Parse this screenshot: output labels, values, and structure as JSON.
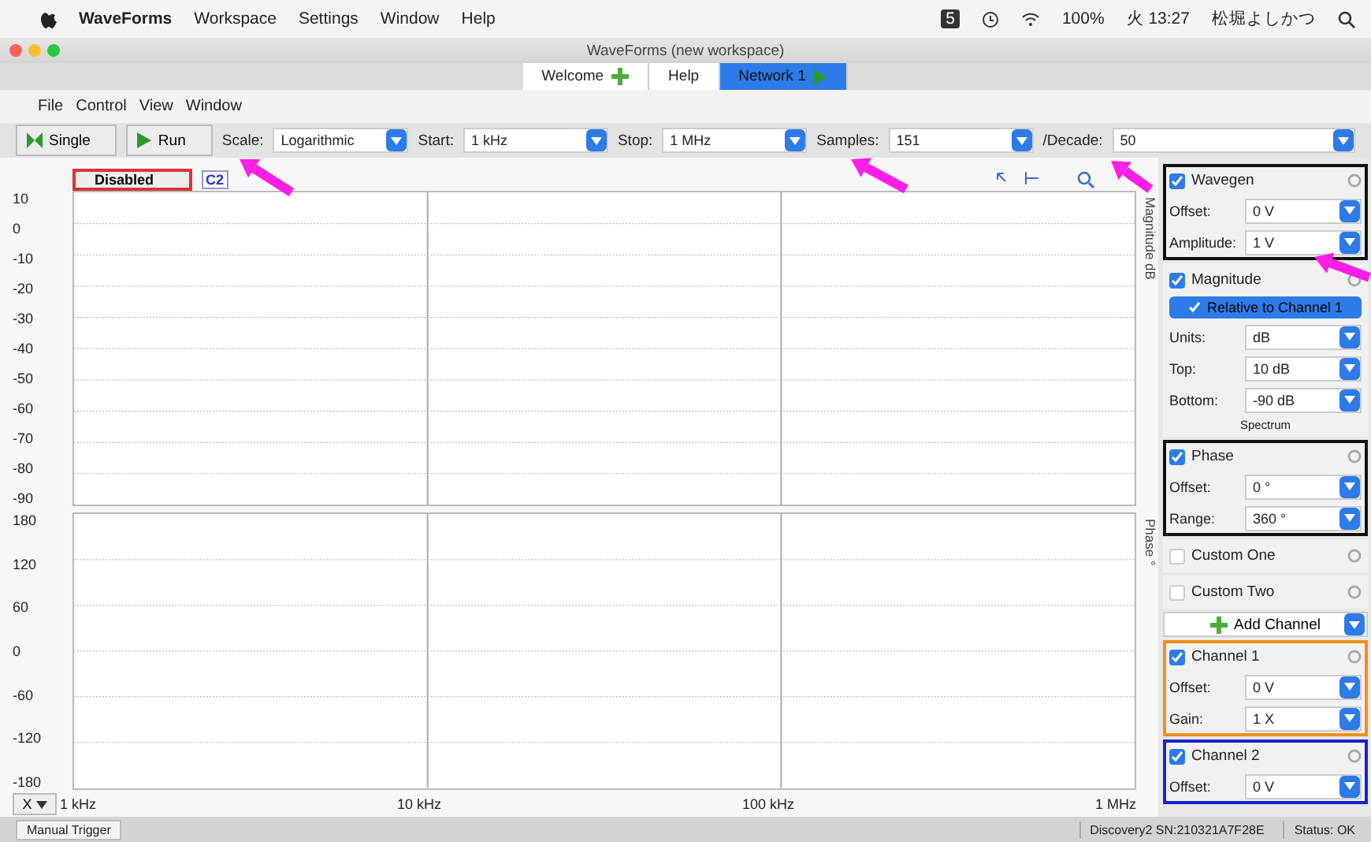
{
  "menubar": {
    "app": "WaveForms",
    "items": [
      "Workspace",
      "Settings",
      "Window",
      "Help"
    ],
    "status_badge": "5",
    "battery": "100%",
    "clock": "火 13:27",
    "user": "松堀よしかつ"
  },
  "window": {
    "title": "WaveForms (new workspace)"
  },
  "tabs": [
    {
      "label": "Welcome",
      "kind": "add",
      "selected": false
    },
    {
      "label": "Help",
      "kind": "plain",
      "selected": false
    },
    {
      "label": "Network 1",
      "kind": "run",
      "selected": true
    }
  ],
  "menu": [
    "File",
    "Control",
    "View",
    "Window"
  ],
  "toolbar": {
    "single": "Single",
    "run": "Run",
    "scale_label": "Scale:",
    "scale": "Logarithmic",
    "start_label": "Start:",
    "start": "1 kHz",
    "stop_label": "Stop:",
    "stop": "1 MHz",
    "samples_label": "Samples:",
    "samples": "151",
    "decade_label": "/Decade:",
    "decade": "50"
  },
  "plot": {
    "disabled": "Disabled",
    "channel_tag": "C2",
    "magnitude": {
      "title": "Magnitude dB",
      "y_labels": [
        "10",
        "0",
        "-10",
        "-20",
        "-30",
        "-40",
        "-50",
        "-60",
        "-70",
        "-80",
        "-90"
      ]
    },
    "phase": {
      "title": "Phase °",
      "y_labels": [
        "180",
        "120",
        "60",
        "0",
        "-60",
        "-120",
        "-180"
      ]
    },
    "x_button": "X",
    "x_labels": [
      "1 kHz",
      "10 kHz",
      "100 kHz",
      "1 MHz"
    ]
  },
  "panel": [
    {
      "kind": "section",
      "title": "Wavegen",
      "checked": true,
      "color": "#111111",
      "fields": [
        {
          "label": "Offset:",
          "value": "0 V"
        },
        {
          "label": "Amplitude:",
          "value": "1 V"
        }
      ]
    },
    {
      "kind": "section",
      "title": "Magnitude",
      "checked": true,
      "button": "Relative to Channel 1",
      "fields": [
        {
          "label": "Units:",
          "value": "dB"
        },
        {
          "label": "Top:",
          "value": "10 dB"
        },
        {
          "label": "Bottom:",
          "value": "-90 dB"
        }
      ],
      "footer": "Spectrum"
    },
    {
      "kind": "section",
      "title": "Phase",
      "checked": true,
      "color": "#111111",
      "fields": [
        {
          "label": "Offset:",
          "value": "0 °"
        },
        {
          "label": "Range:",
          "value": "360 °"
        }
      ]
    },
    {
      "kind": "section",
      "title": "Custom One",
      "checked": false
    },
    {
      "kind": "section",
      "title": "Custom Two",
      "checked": false
    },
    {
      "kind": "add",
      "title": "Add Channel"
    },
    {
      "kind": "section",
      "title": "Channel 1",
      "checked": true,
      "color": "#f0901c",
      "fields": [
        {
          "label": "Offset:",
          "value": "0 V"
        },
        {
          "label": "Gain:",
          "value": "1 X"
        }
      ]
    },
    {
      "kind": "section",
      "title": "Channel 2",
      "checked": true,
      "color": "#1a22cc",
      "fields": [
        {
          "label": "Offset:",
          "value": "0 V"
        }
      ]
    }
  ],
  "status_bar": {
    "tab": "Manual Trigger",
    "device": "Discovery2 SN:210321A7F28E",
    "status": "Status: OK"
  }
}
